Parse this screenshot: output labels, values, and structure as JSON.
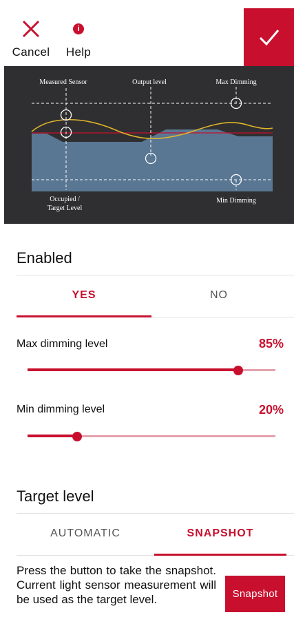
{
  "header": {
    "cancel_label": "Cancel",
    "help_label": "Help",
    "help_icon": "info-icon",
    "confirm_icon": "checkmark-icon"
  },
  "diagram": {
    "measured_sensor": "Measured Sensor",
    "output_level": "Output level",
    "max_dimming": "Max Dimming",
    "min_dimming": "Min Dimming",
    "occupied_line1": "Occupied /",
    "occupied_line2": "Target Level"
  },
  "enabled": {
    "title": "Enabled",
    "tabs": [
      "YES",
      "NO"
    ],
    "selected": "YES"
  },
  "max_dimming": {
    "label": "Max dimming level",
    "value_text": "85%",
    "value": 0.85
  },
  "min_dimming": {
    "label": "Min dimming level",
    "value_text": "20%",
    "value": 0.2
  },
  "target": {
    "title": "Target level",
    "tabs": [
      "AUTOMATIC",
      "SNAPSHOT"
    ],
    "selected": "SNAPSHOT",
    "description": "Press the button to take the snapshot. Current light sensor measurement will be used as the target level.",
    "button_label": "Snapshot"
  },
  "colors": {
    "accent": "#c8102e",
    "accent_light": "#e4a1ad",
    "diagram_bg": "#2f2f31",
    "sensor_curve": "#e0b52a",
    "fill_area": "#5e7f9e"
  }
}
